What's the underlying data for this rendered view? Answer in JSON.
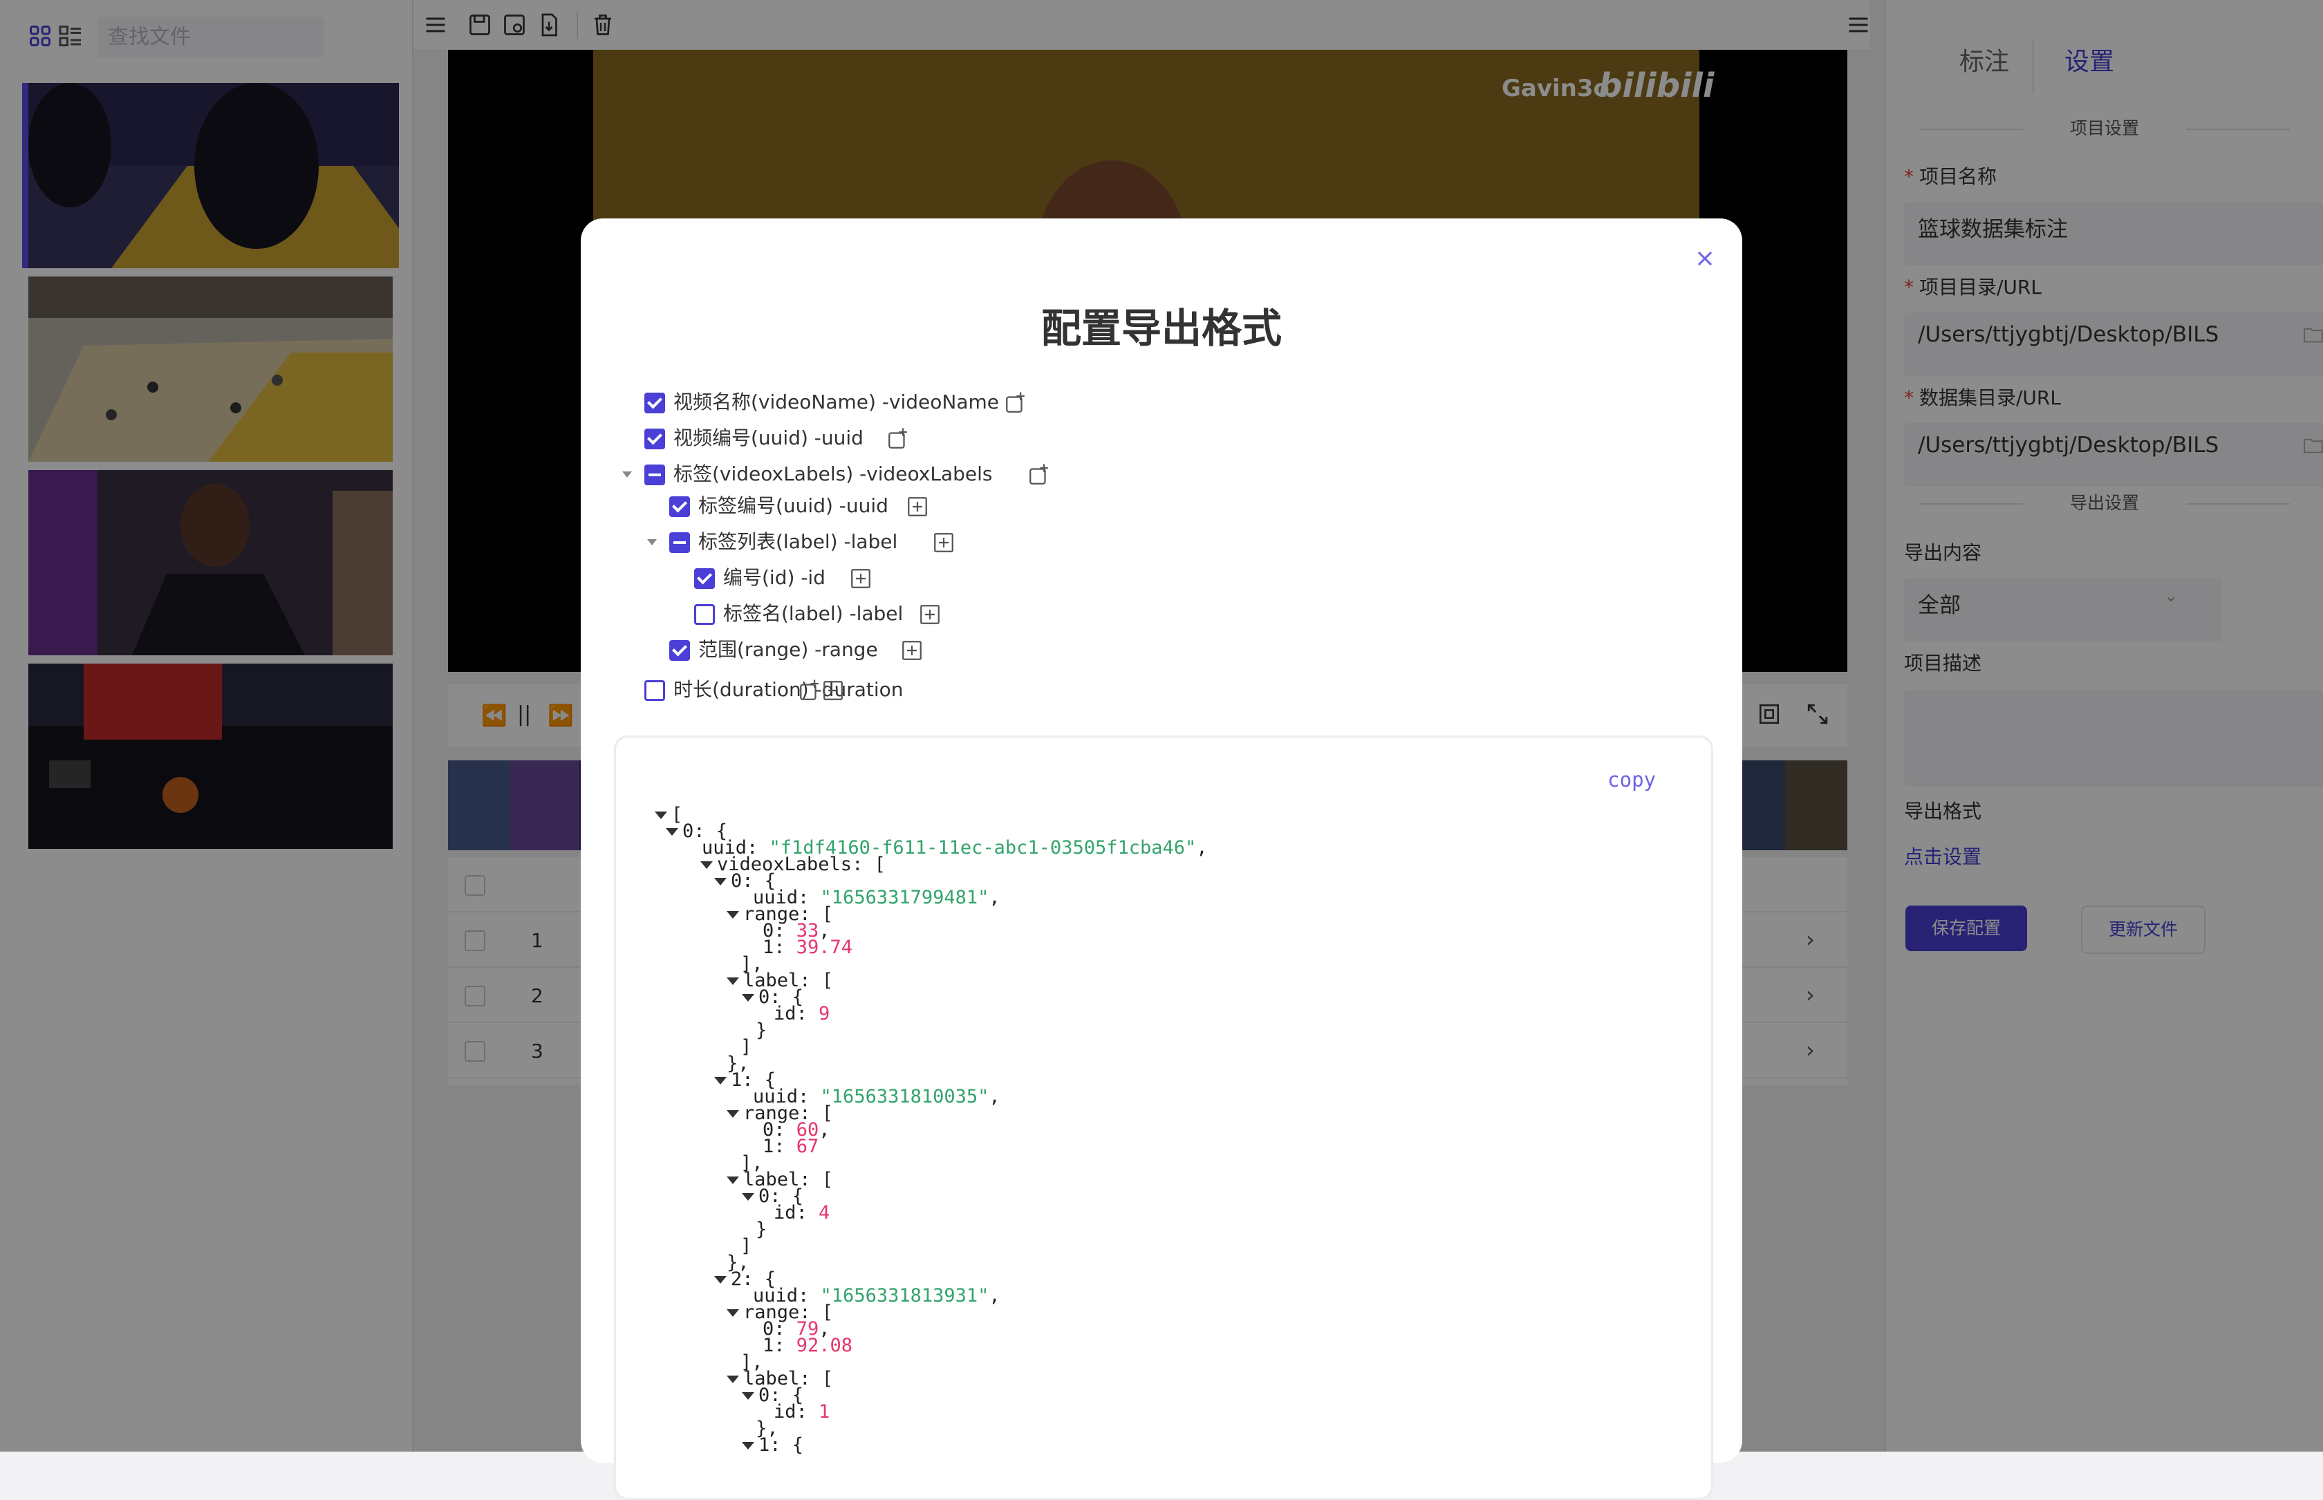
{
  "left": {
    "search_placeholder": "查找文件",
    "view_icons": [
      "grid-view-icon",
      "list-view-icon"
    ],
    "thumbnails": [
      {
        "caption": "thumbnail-1",
        "selected": true
      },
      {
        "caption": "thumbnail-2",
        "selected": false
      },
      {
        "caption": "thumbnail-3",
        "selected": false
      },
      {
        "caption": "thumbnail-4",
        "selected": false
      }
    ]
  },
  "video": {
    "watermark_channel": "Gavin3o",
    "watermark_brand": "bilibili"
  },
  "table": {
    "rows": [
      "1",
      "2",
      "3"
    ]
  },
  "right": {
    "tabs": [
      "标注",
      "设置"
    ],
    "active_tab": "设置",
    "section_project": "项目设置",
    "project_name_label": "项目名称",
    "project_name_value": "篮球数据集标注",
    "project_dir_label": "项目目录/URL",
    "project_dir_value": "/Users/ttjygbtj/Desktop/BILS",
    "dataset_dir_label": "数据集目录/URL",
    "dataset_dir_value": "/Users/ttjygbtj/Desktop/BILS",
    "section_export": "导出设置",
    "export_content_label": "导出内容",
    "export_content_value": "全部",
    "description_label": "项目描述",
    "export_format_label": "导出格式",
    "export_format_link": "点击设置",
    "save_button": "保存配置",
    "update_button": "更新文件",
    "accent_color": "#4a3fd6"
  },
  "modal": {
    "title": "配置导出格式",
    "copy_label": "copy",
    "tree": [
      {
        "label": "视频名称(videoName) -videoName",
        "state": "checked"
      },
      {
        "label": "视频编号(uuid) -uuid",
        "state": "checked"
      },
      {
        "label": "标签(videoxLabels) -videoxLabels",
        "state": "indeterminate"
      },
      {
        "label": "标签编号(uuid) -uuid",
        "state": "checked"
      },
      {
        "label": "标签列表(label) -label",
        "state": "indeterminate"
      },
      {
        "label": "编号(id) -id",
        "state": "checked"
      },
      {
        "label": "标签名(label) -label",
        "state": "unchecked"
      },
      {
        "label": "范围(range) -range",
        "state": "checked"
      },
      {
        "label": "时长(duration) -duration",
        "state": "unchecked"
      }
    ],
    "json_lines": [
      {
        "t": "["
      },
      {
        "t": "0: {"
      },
      {
        "t": "uuid: ",
        "s": "\"f1df4160-f611-11ec-abc1-03505f1cba46\"",
        "e": ","
      },
      {
        "t": "videoxLabels: ["
      },
      {
        "t": "0: {"
      },
      {
        "t": "uuid: ",
        "s": "\"1656331799481\"",
        "e": ","
      },
      {
        "t": "range: ["
      },
      {
        "t": "0: ",
        "n": "33",
        "e": ","
      },
      {
        "t": "1: ",
        "n": "39.74"
      },
      {
        "t": "],"
      },
      {
        "t": "label: ["
      },
      {
        "t": "0: {"
      },
      {
        "t": "id: ",
        "n": "9"
      },
      {
        "t": "}"
      },
      {
        "t": "]"
      },
      {
        "t": "},"
      },
      {
        "t": "1: {"
      },
      {
        "t": "uuid: ",
        "s": "\"1656331810035\"",
        "e": ","
      },
      {
        "t": "range: ["
      },
      {
        "t": "0: ",
        "n": "60",
        "e": ","
      },
      {
        "t": "1: ",
        "n": "67"
      },
      {
        "t": "],"
      },
      {
        "t": "label: ["
      },
      {
        "t": "0: {"
      },
      {
        "t": "id: ",
        "n": "4"
      },
      {
        "t": "}"
      },
      {
        "t": "]"
      },
      {
        "t": "},"
      },
      {
        "t": "2: {"
      },
      {
        "t": "uuid: ",
        "s": "\"1656331813931\"",
        "e": ","
      },
      {
        "t": "range: ["
      },
      {
        "t": "0: ",
        "n": "79",
        "e": ","
      },
      {
        "t": "1: ",
        "n": "92.08"
      },
      {
        "t": "],"
      },
      {
        "t": "label: ["
      },
      {
        "t": "0: {"
      },
      {
        "t": "id: ",
        "n": "1"
      },
      {
        "t": "},"
      },
      {
        "t": "1: {"
      }
    ]
  }
}
